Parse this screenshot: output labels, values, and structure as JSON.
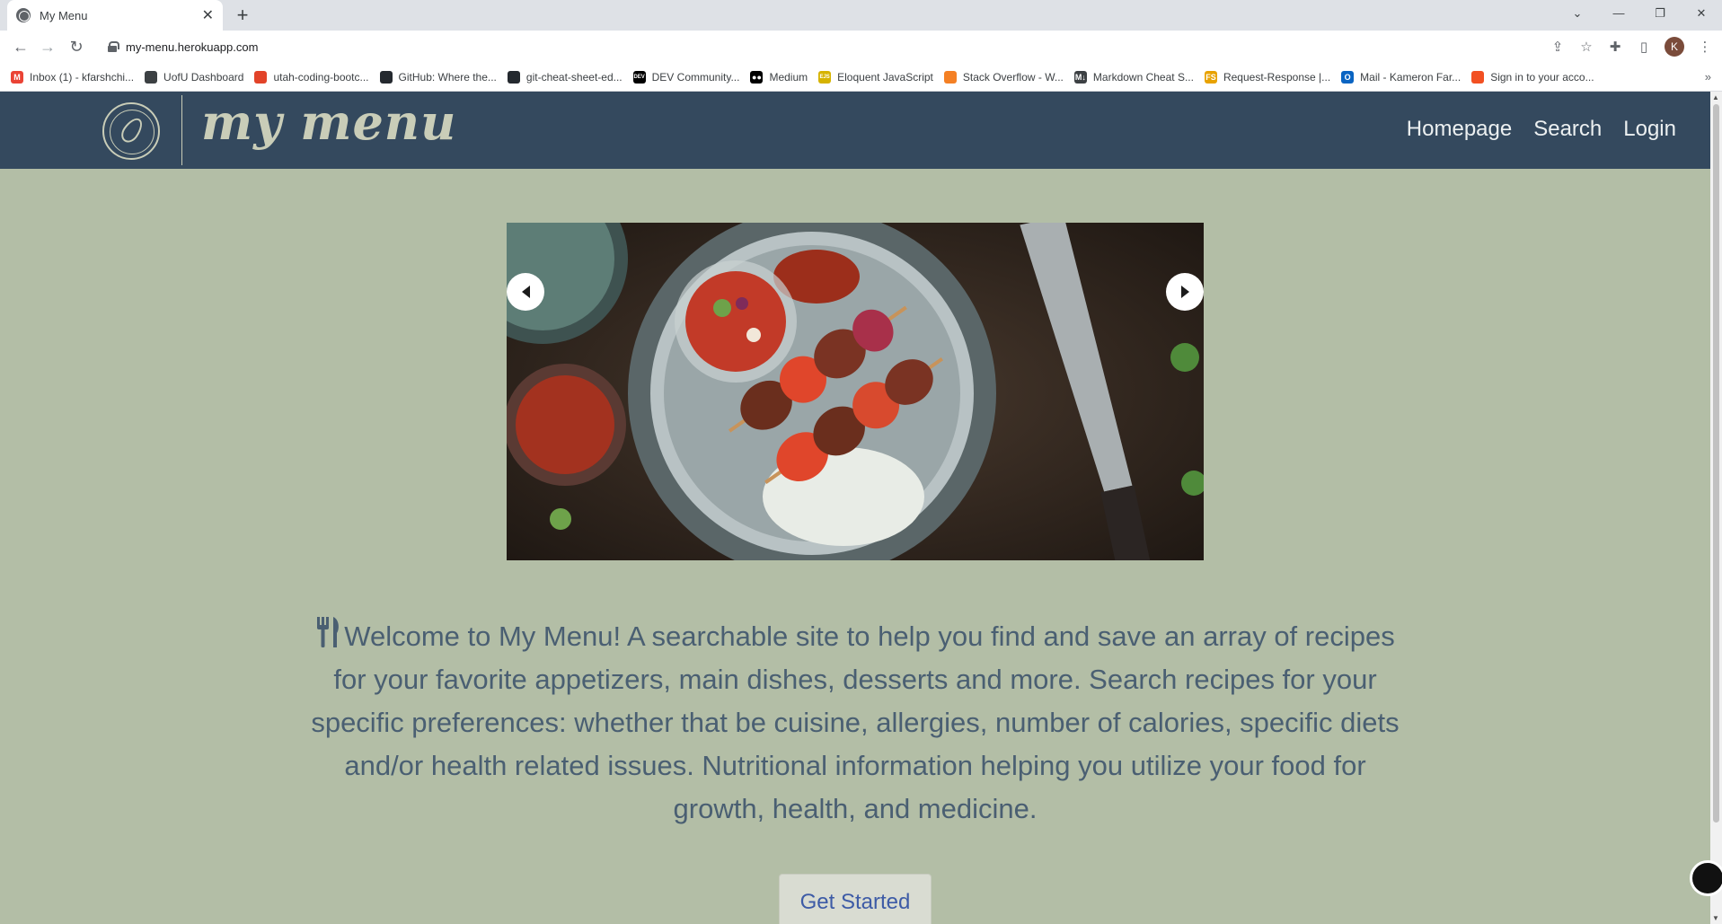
{
  "browser": {
    "tab_title": "My Menu",
    "tab_close": "✕",
    "new_tab": "+",
    "url": "my-menu.herokuapp.com",
    "avatar_letter": "K",
    "bookmarks": [
      {
        "label": "Inbox (1) - kfarshchi...",
        "icon": "gmail-icon",
        "color": "#ea4335",
        "glyph": "M"
      },
      {
        "label": "UofU Dashboard",
        "icon": "compass-icon",
        "color": "#3c4043",
        "glyph": ""
      },
      {
        "label": "utah-coding-bootc...",
        "icon": "gitlab-icon",
        "color": "#e24329",
        "glyph": ""
      },
      {
        "label": "GitHub: Where the...",
        "icon": "github-icon",
        "color": "#24292f",
        "glyph": ""
      },
      {
        "label": "git-cheat-sheet-ed...",
        "icon": "github-icon",
        "color": "#24292f",
        "glyph": ""
      },
      {
        "label": "DEV Community...",
        "icon": "dev-icon",
        "color": "#000000",
        "glyph": "DEV"
      },
      {
        "label": "Medium",
        "icon": "medium-icon",
        "color": "#000000",
        "glyph": "●●"
      },
      {
        "label": "Eloquent JavaScript",
        "icon": "ejs-icon",
        "color": "#d6b300",
        "glyph": "EJS"
      },
      {
        "label": "Stack Overflow - W...",
        "icon": "stackoverflow-icon",
        "color": "#f48024",
        "glyph": ""
      },
      {
        "label": "Markdown Cheat S...",
        "icon": "markdown-icon",
        "color": "#3c4043",
        "glyph": "M↓"
      },
      {
        "label": "Request-Response |...",
        "icon": "fs-icon",
        "color": "#e8a200",
        "glyph": "FS"
      },
      {
        "label": "Mail - Kameron Far...",
        "icon": "outlook-icon",
        "color": "#0a64c2",
        "glyph": "O"
      },
      {
        "label": "Sign in to your acco...",
        "icon": "microsoft-icon",
        "color": "#f25022",
        "glyph": ""
      }
    ]
  },
  "site": {
    "brand": "my menu",
    "nav": [
      "Homepage",
      "Search",
      "Login"
    ],
    "welcome": "Welcome to My Menu! A searchable site to help you find and save an array of recipes for your favorite appetizers, main dishes, desserts and more. Search recipes for your specific preferences: whether that be cuisine, allergies, number of calories, specific diets and/or health related issues. Nutritional information helping you utilize your food for growth, health, and medicine.",
    "cta": "Get Started"
  },
  "colors": {
    "page_bg": "#b3bea6",
    "header_bg": "#34495e",
    "text": "#4a5f72",
    "cta_text": "#3d5ba6"
  }
}
